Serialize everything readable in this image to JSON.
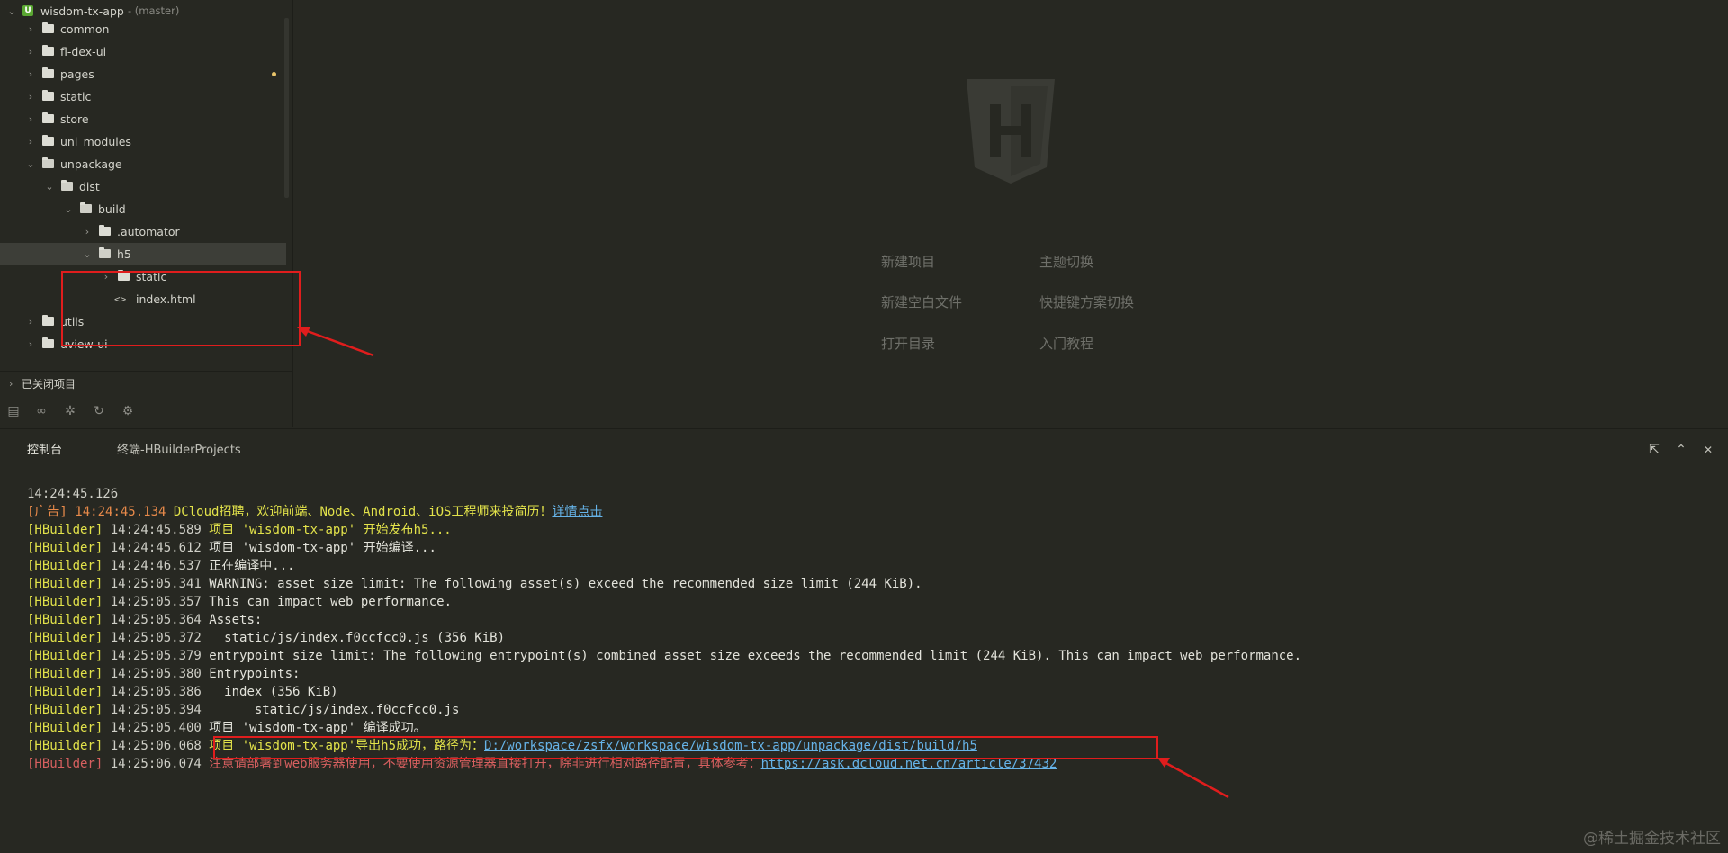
{
  "project": {
    "name": "wisdom-tx-app",
    "branch": "- (master)",
    "icon_letter": "U"
  },
  "tree": [
    {
      "label": "common",
      "depth": 1,
      "type": "folder",
      "expanded": false
    },
    {
      "label": "fl-dex-ui",
      "depth": 1,
      "type": "folder",
      "expanded": false
    },
    {
      "label": "pages",
      "depth": 1,
      "type": "folder",
      "expanded": false,
      "modified": true
    },
    {
      "label": "static",
      "depth": 1,
      "type": "folder",
      "expanded": false
    },
    {
      "label": "store",
      "depth": 1,
      "type": "folder",
      "expanded": false
    },
    {
      "label": "uni_modules",
      "depth": 1,
      "type": "folder",
      "expanded": false
    },
    {
      "label": "unpackage",
      "depth": 1,
      "type": "folder",
      "expanded": true
    },
    {
      "label": "dist",
      "depth": 2,
      "type": "folder",
      "expanded": true
    },
    {
      "label": "build",
      "depth": 3,
      "type": "folder",
      "expanded": true
    },
    {
      "label": ".automator",
      "depth": 4,
      "type": "folder",
      "expanded": false
    },
    {
      "label": "h5",
      "depth": 4,
      "type": "folder",
      "expanded": true,
      "selected": true
    },
    {
      "label": "static",
      "depth": 5,
      "type": "folder",
      "expanded": false
    },
    {
      "label": "index.html",
      "depth": 5,
      "type": "file"
    },
    {
      "label": "utils",
      "depth": 1,
      "type": "folder",
      "expanded": false
    },
    {
      "label": "uview-ui",
      "depth": 1,
      "type": "folder",
      "expanded": false
    }
  ],
  "closed_projects": "已关闭项目",
  "sidebar_tools": [
    "project-manager-icon",
    "binoculars-icon",
    "bug-icon",
    "refresh-icon",
    "plugin-icon"
  ],
  "welcome": {
    "links": [
      {
        "label": "新建项目",
        "col": 0,
        "row": 0
      },
      {
        "label": "主题切换",
        "col": 1,
        "row": 0
      },
      {
        "label": "新建空白文件",
        "col": 0,
        "row": 1
      },
      {
        "label": "快捷键方案切换",
        "col": 1,
        "row": 1
      },
      {
        "label": "打开目录",
        "col": 0,
        "row": 2
      },
      {
        "label": "入门教程",
        "col": 1,
        "row": 2
      }
    ]
  },
  "panel": {
    "tabs": [
      {
        "label": "控制台",
        "active": true
      },
      {
        "label": "终端-HBuilderProjects",
        "active": false
      }
    ]
  },
  "console": [
    {
      "parts": [
        {
          "t": "14:24:45.126",
          "c": "ts"
        }
      ]
    },
    {
      "parts": [
        {
          "t": "[广告] ",
          "c": "ad"
        },
        {
          "t": "14:24:45.134 ",
          "c": "ad"
        },
        {
          "t": "DCloud招聘，欢迎前端、Node、Android、iOS工程师来投简历！",
          "c": "yel"
        },
        {
          "t": "详情点击",
          "c": "lnk"
        }
      ]
    },
    {
      "parts": [
        {
          "t": "[HBuilder] ",
          "c": "tag"
        },
        {
          "t": "14:24:45.589 ",
          "c": "ts"
        },
        {
          "t": "项目 'wisdom-tx-app' 开始发布h5...",
          "c": "yel"
        }
      ]
    },
    {
      "parts": [
        {
          "t": "[HBuilder] ",
          "c": "tag"
        },
        {
          "t": "14:24:45.612 ",
          "c": "ts"
        },
        {
          "t": "项目 'wisdom-tx-app' 开始编译...",
          "c": ""
        }
      ]
    },
    {
      "parts": [
        {
          "t": "[HBuilder] ",
          "c": "tag"
        },
        {
          "t": "14:24:46.537 ",
          "c": "ts"
        },
        {
          "t": "正在编译中...",
          "c": ""
        }
      ]
    },
    {
      "parts": [
        {
          "t": "[HBuilder] ",
          "c": "tag"
        },
        {
          "t": "14:25:05.341 ",
          "c": "ts"
        },
        {
          "t": "WARNING: asset size limit: The following asset(s) exceed the recommended size limit (244 KiB).",
          "c": ""
        }
      ]
    },
    {
      "parts": [
        {
          "t": "[HBuilder] ",
          "c": "tag"
        },
        {
          "t": "14:25:05.357 ",
          "c": "ts"
        },
        {
          "t": "This can impact web performance.",
          "c": ""
        }
      ]
    },
    {
      "parts": [
        {
          "t": "[HBuilder] ",
          "c": "tag"
        },
        {
          "t": "14:25:05.364 ",
          "c": "ts"
        },
        {
          "t": "Assets:",
          "c": ""
        }
      ]
    },
    {
      "parts": [
        {
          "t": "[HBuilder] ",
          "c": "tag"
        },
        {
          "t": "14:25:05.372 ",
          "c": "ts"
        },
        {
          "t": "  static/js/index.f0ccfcc0.js (356 KiB)",
          "c": ""
        }
      ]
    },
    {
      "parts": [
        {
          "t": "[HBuilder] ",
          "c": "tag"
        },
        {
          "t": "14:25:05.379 ",
          "c": "ts"
        },
        {
          "t": "entrypoint size limit: The following entrypoint(s) combined asset size exceeds the recommended limit (244 KiB). This can impact web performance.",
          "c": ""
        }
      ]
    },
    {
      "parts": [
        {
          "t": "[HBuilder] ",
          "c": "tag"
        },
        {
          "t": "14:25:05.380 ",
          "c": "ts"
        },
        {
          "t": "Entrypoints:",
          "c": ""
        }
      ]
    },
    {
      "parts": [
        {
          "t": "[HBuilder] ",
          "c": "tag"
        },
        {
          "t": "14:25:05.386 ",
          "c": "ts"
        },
        {
          "t": "  index (356 KiB)",
          "c": ""
        }
      ]
    },
    {
      "parts": [
        {
          "t": "[HBuilder] ",
          "c": "tag"
        },
        {
          "t": "14:25:05.394 ",
          "c": "ts"
        },
        {
          "t": "      static/js/index.f0ccfcc0.js",
          "c": ""
        }
      ]
    },
    {
      "parts": [
        {
          "t": "[HBuilder] ",
          "c": "tag"
        },
        {
          "t": "14:25:05.400 ",
          "c": "ts"
        },
        {
          "t": "项目 'wisdom-tx-app' 编译成功。",
          "c": ""
        }
      ]
    },
    {
      "parts": [
        {
          "t": "[HBuilder] ",
          "c": "tag"
        },
        {
          "t": "14:25:06.068 ",
          "c": "ts"
        },
        {
          "t": "项目 'wisdom-tx-app'导出h5成功，路径为：",
          "c": "yel"
        },
        {
          "t": "D:/workspace/zsfx/workspace/wisdom-tx-app/unpackage/dist/build/h5",
          "c": "lnk"
        }
      ]
    },
    {
      "parts": [
        {
          "t": "[HBuilder] ",
          "c": "tag-red"
        },
        {
          "t": "14:25:06.074 ",
          "c": "ts"
        },
        {
          "t": "注意请部署到web服务器使用，不要使用资源管理器直接打开，除非进行相对路径配置，具体参考：",
          "c": "redtxt"
        },
        {
          "t": "https://ask.dcloud.net.cn/article/37432",
          "c": "lnk"
        }
      ]
    }
  ],
  "watermark": "@稀土掘金技术社区",
  "colors": {
    "background": "#272822",
    "highlight": "#e2e24a",
    "link": "#66b3e8",
    "error": "#d86060",
    "annotation": "#e01d1d"
  }
}
